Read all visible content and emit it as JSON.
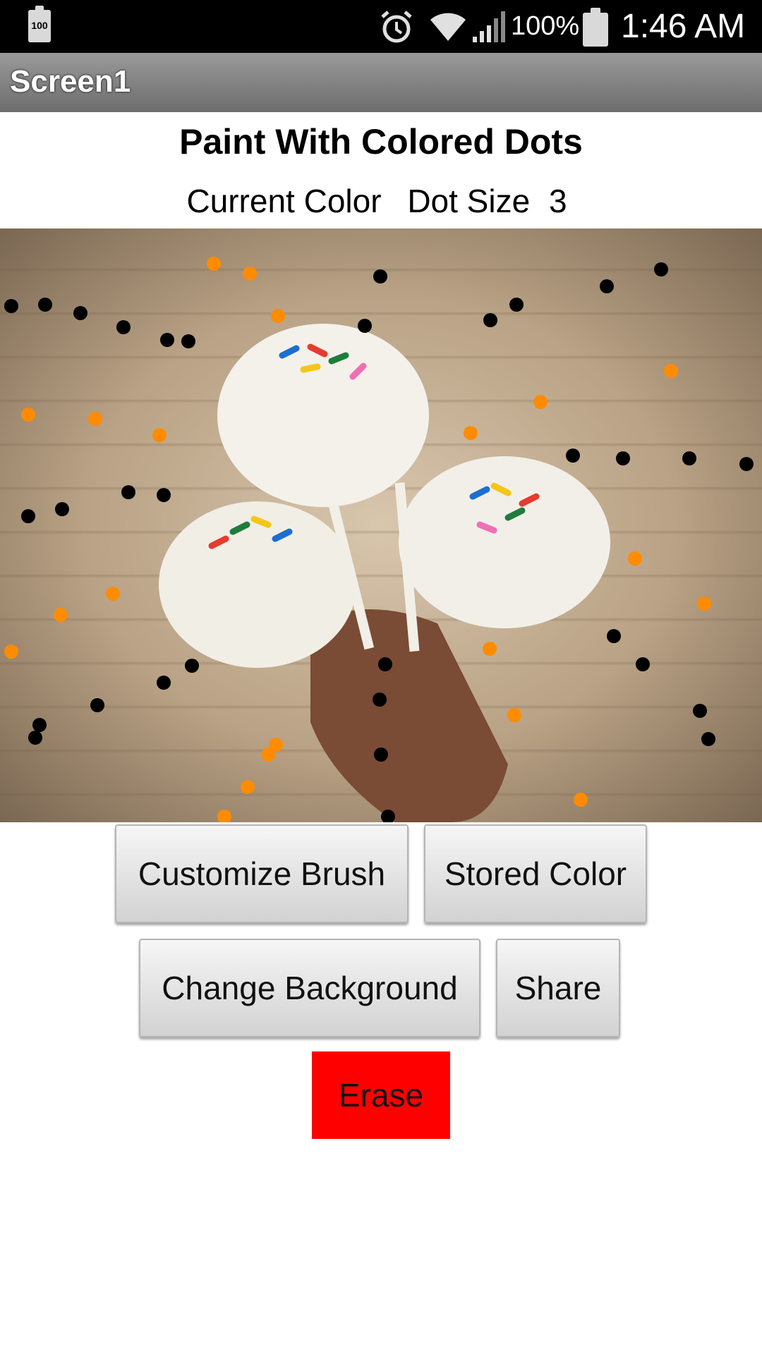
{
  "status_bar": {
    "battery_small_label": "100",
    "battery_percent": "100%",
    "time": "1:46 AM",
    "icons": [
      "battery-icon",
      "alarm-icon",
      "wifi-icon",
      "signal-icon",
      "battery-full-icon"
    ]
  },
  "title_bar": {
    "title": "Screen1"
  },
  "app": {
    "heading": "Paint With Colored Dots",
    "current_color_label": "Current Color",
    "dot_size_label": "Dot Size",
    "dot_size_value": "3"
  },
  "buttons": {
    "customize_brush": "Customize Brush",
    "stored_color": "Stored Color",
    "change_background": "Change Background",
    "share": "Share",
    "erase": "Erase"
  },
  "colors": {
    "black_dot": "#000000",
    "orange_dot": "#ff8c00",
    "erase_button": "#ff0000"
  },
  "canvas": {
    "background_description_icon": "cake-pops-photo"
  }
}
